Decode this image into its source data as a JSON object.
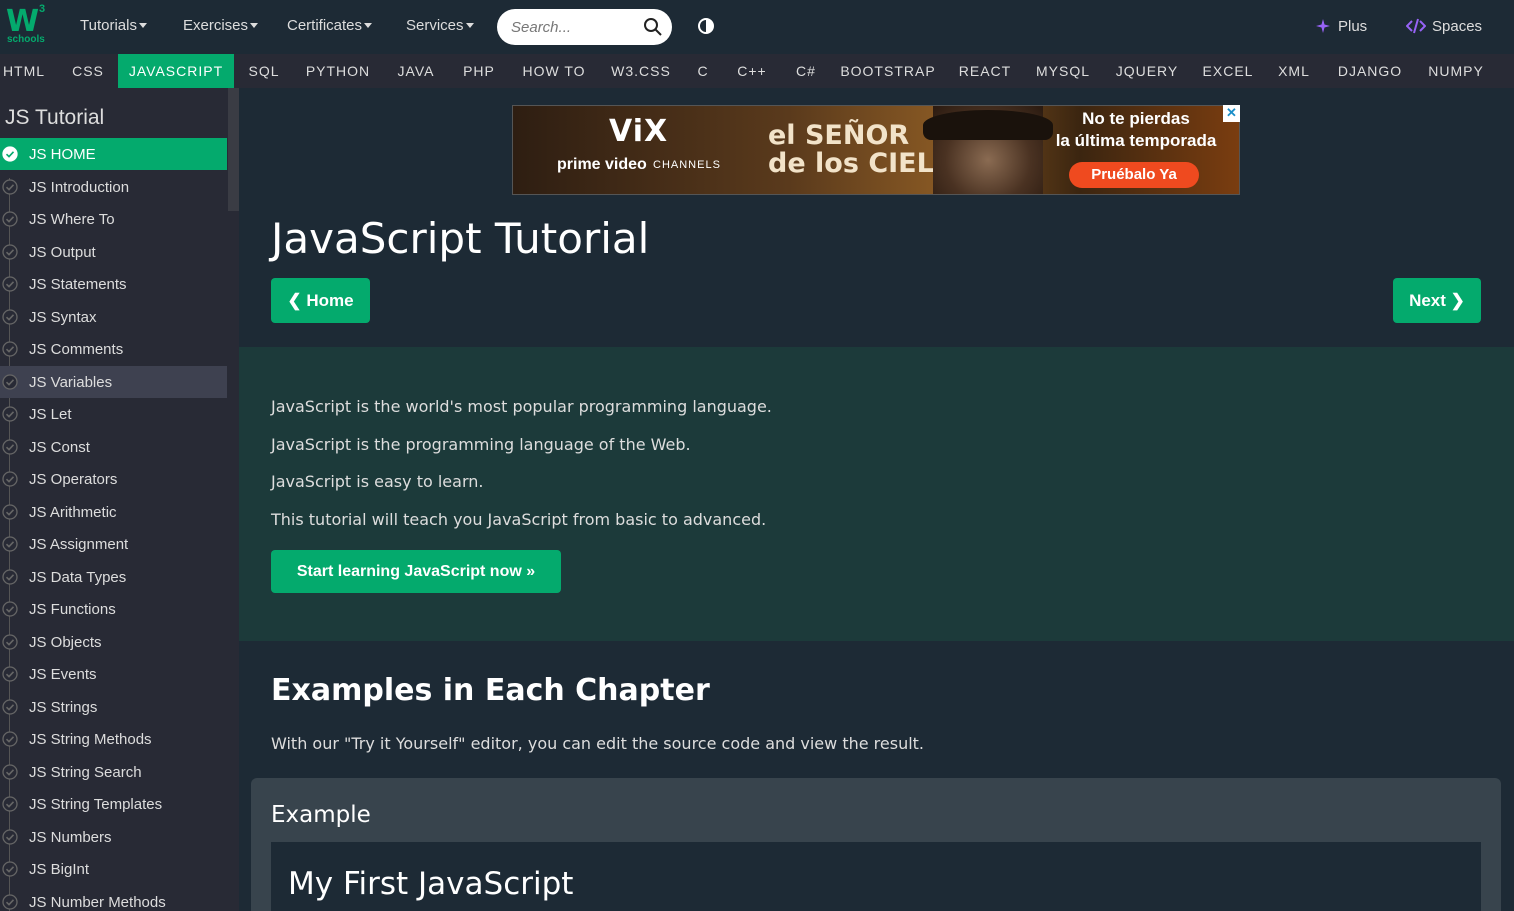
{
  "brand": {
    "logo_main": "W",
    "logo_sup": "3",
    "logo_sub": "schools"
  },
  "topnav": {
    "tutorials": "Tutorials",
    "exercises": "Exercises",
    "certificates": "Certificates",
    "services": "Services",
    "search_placeholder": "Search...",
    "plus": "Plus",
    "spaces": "Spaces"
  },
  "subjects": [
    "HTML",
    "CSS",
    "JAVASCRIPT",
    "SQL",
    "PYTHON",
    "JAVA",
    "PHP",
    "HOW TO",
    "W3.CSS",
    "C",
    "C++",
    "C#",
    "BOOTSTRAP",
    "REACT",
    "MYSQL",
    "JQUERY",
    "EXCEL",
    "XML",
    "DJANGO",
    "NUMPY"
  ],
  "active_subject": "JAVASCRIPT",
  "sidebar": {
    "title": "JS Tutorial",
    "items": [
      "JS HOME",
      "JS Introduction",
      "JS Where To",
      "JS Output",
      "JS Statements",
      "JS Syntax",
      "JS Comments",
      "JS Variables",
      "JS Let",
      "JS Const",
      "JS Operators",
      "JS Arithmetic",
      "JS Assignment",
      "JS Data Types",
      "JS Functions",
      "JS Objects",
      "JS Events",
      "JS Strings",
      "JS String Methods",
      "JS String Search",
      "JS String Templates",
      "JS Numbers",
      "JS BigInt",
      "JS Number Methods"
    ]
  },
  "ad": {
    "brand": "ViX",
    "prime": "prime video",
    "channels": "CHANNELS",
    "show_line1": "el SEÑOR",
    "show_line2": "de los CIELOS",
    "headline1": "No te pierdas",
    "headline2": "la última temporada",
    "cta": "Pruébalo Ya",
    "close": "✕"
  },
  "main": {
    "title": "JavaScript Tutorial",
    "home_btn": "❮ Home",
    "next_btn": "Next ❯",
    "intro": [
      "JavaScript is the world's most popular programming language.",
      "JavaScript is the programming language of the Web.",
      "JavaScript is easy to learn.",
      "This tutorial will teach you JavaScript from basic to advanced."
    ],
    "start_btn": "Start learning JavaScript now »",
    "examples_heading": "Examples in Each Chapter",
    "examples_text": "With our \"Try it Yourself\" editor, you can edit the source code and view the result.",
    "example_label": "Example",
    "example_heading": "My First JavaScript"
  },
  "colors": {
    "accent": "#04aa6d",
    "bg": "#1d2a35",
    "panel": "#282a35",
    "intro_bg": "#1c3a3a"
  }
}
